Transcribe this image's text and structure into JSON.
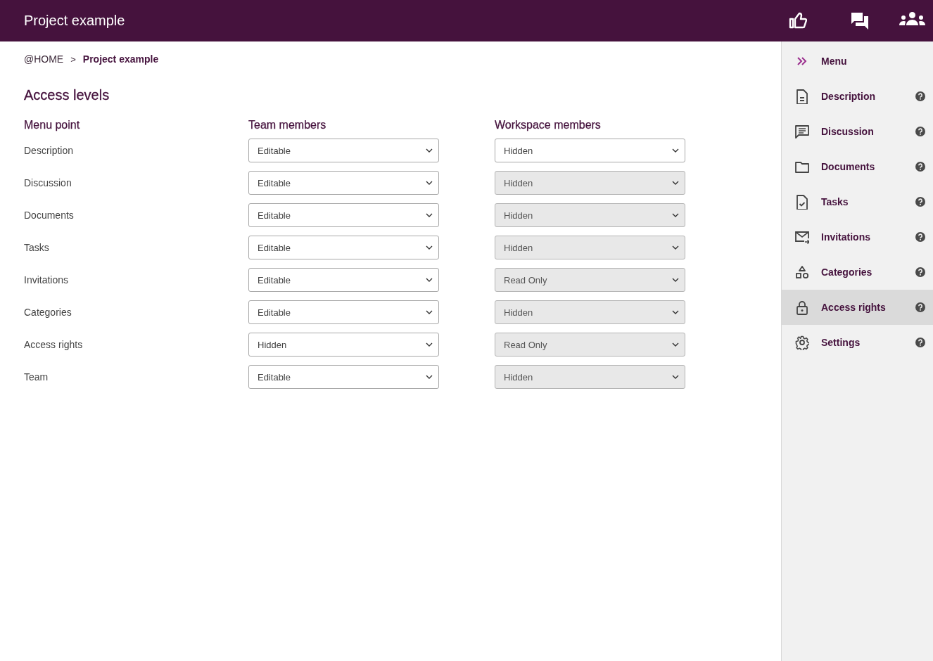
{
  "header": {
    "title": "Project example"
  },
  "breadcrumb": [
    "@HOME",
    "Project example"
  ],
  "breadcrumb_separator": ">",
  "heading": "Access levels",
  "table": {
    "columns": [
      "Menu point",
      "Team members",
      "Workspace members"
    ],
    "rows": [
      {
        "label": "Description",
        "team": {
          "value": "Editable",
          "disabled": false
        },
        "workspace": {
          "value": "Hidden",
          "disabled": false
        }
      },
      {
        "label": "Discussion",
        "team": {
          "value": "Editable",
          "disabled": false
        },
        "workspace": {
          "value": "Hidden",
          "disabled": true
        }
      },
      {
        "label": "Documents",
        "team": {
          "value": "Editable",
          "disabled": false
        },
        "workspace": {
          "value": "Hidden",
          "disabled": true
        }
      },
      {
        "label": "Tasks",
        "team": {
          "value": "Editable",
          "disabled": false
        },
        "workspace": {
          "value": "Hidden",
          "disabled": true
        }
      },
      {
        "label": "Invitations",
        "team": {
          "value": "Editable",
          "disabled": false
        },
        "workspace": {
          "value": "Read Only",
          "disabled": true
        }
      },
      {
        "label": "Categories",
        "team": {
          "value": "Editable",
          "disabled": false
        },
        "workspace": {
          "value": "Hidden",
          "disabled": true
        }
      },
      {
        "label": "Access rights",
        "team": {
          "value": "Hidden",
          "disabled": false
        },
        "workspace": {
          "value": "Read Only",
          "disabled": true
        }
      },
      {
        "label": "Team",
        "team": {
          "value": "Editable",
          "disabled": false
        },
        "workspace": {
          "value": "Hidden",
          "disabled": true
        }
      }
    ]
  },
  "sidebar": {
    "title": "Menu",
    "items": [
      {
        "label": "Description",
        "selected": false
      },
      {
        "label": "Discussion",
        "selected": false
      },
      {
        "label": "Documents",
        "selected": false
      },
      {
        "label": "Tasks",
        "selected": false
      },
      {
        "label": "Invitations",
        "selected": false
      },
      {
        "label": "Categories",
        "selected": false
      },
      {
        "label": "Access rights",
        "selected": true
      },
      {
        "label": "Settings",
        "selected": false
      }
    ]
  }
}
